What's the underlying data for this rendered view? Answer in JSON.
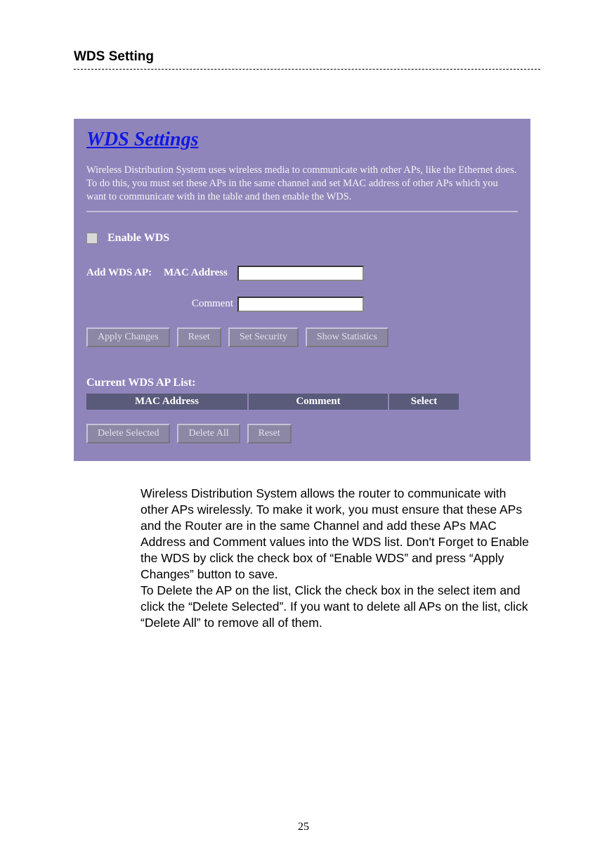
{
  "doc": {
    "title": "WDS Setting",
    "page_number": "25",
    "paragraph1": "Wireless Distribution System allows the router to communicate with other APs wirelessly. To make it work, you must ensure that these APs and the Router are in the same Channel and add these APs MAC Address and Comment values into the WDS list. Don't Forget to Enable the WDS by click the check box of “Enable WDS” and press “Apply Changes” button to save.",
    "paragraph2": "To Delete the AP on the list, Click the check box in the select item and click the “Delete Selected”. If you want to delete all APs on the list, click “Delete All” to remove all of them."
  },
  "panel": {
    "title": "WDS Settings",
    "description": "Wireless Distribution System uses wireless media to communicate with other APs, like the Ethernet does. To do this, you must set these APs in the same channel and set MAC address of other APs which you want to communicate with in the table and then enable the WDS.",
    "enable_label": "Enable WDS",
    "add_label": "Add WDS AP:",
    "mac_label": "MAC Address",
    "comment_label": "Comment",
    "buttons": {
      "apply": "Apply Changes",
      "reset1": "Reset",
      "set_security": "Set Security",
      "show_stats": "Show Statistics",
      "delete_selected": "Delete Selected",
      "delete_all": "Delete All",
      "reset2": "Reset"
    },
    "list_title": "Current WDS AP List:",
    "columns": {
      "mac": "MAC Address",
      "comment": "Comment",
      "select": "Select"
    }
  }
}
